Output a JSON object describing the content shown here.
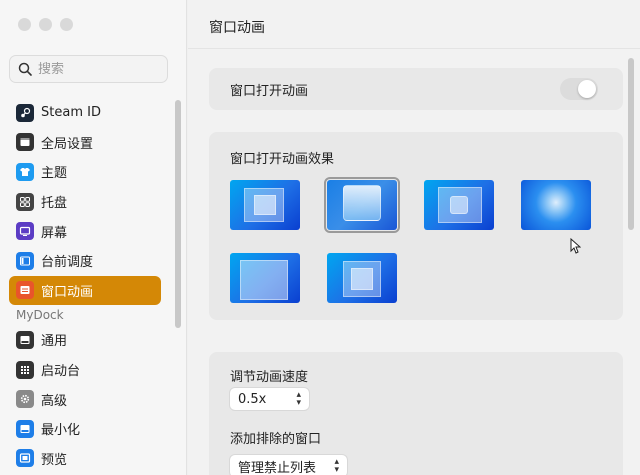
{
  "sidebar": {
    "search_placeholder": "搜索",
    "items": [
      {
        "label": "Steam ID",
        "icon": "steam-icon",
        "color": "#1b2838"
      },
      {
        "label": "全局设置",
        "icon": "window-icon",
        "color": "#333333"
      },
      {
        "label": "主题",
        "icon": "shirt-icon",
        "color": "#1e9bf0"
      },
      {
        "label": "托盘",
        "icon": "tray-grid-icon",
        "color": "#444444"
      },
      {
        "label": "屏幕",
        "icon": "screen-icon",
        "color": "#5b3cc4"
      },
      {
        "label": "台前调度",
        "icon": "stage-manager-icon",
        "color": "#1e7ee8"
      },
      {
        "label": "窗口动画",
        "icon": "window-animation-icon",
        "color": "#ffffff",
        "active": true
      }
    ],
    "section_label": "MyDock",
    "items2": [
      {
        "label": "通用",
        "icon": "general-icon",
        "color": "#333333"
      },
      {
        "label": "启动台",
        "icon": "launchpad-icon",
        "color": "#333333"
      },
      {
        "label": "高级",
        "icon": "gear-icon",
        "color": "#8a8a8a"
      },
      {
        "label": "最小化",
        "icon": "minimize-icon",
        "color": "#1e7ee8"
      },
      {
        "label": "预览",
        "icon": "preview-icon",
        "color": "#1e7ee8"
      }
    ]
  },
  "main": {
    "title": "窗口动画",
    "open_animation_label": "窗口打开动画",
    "open_animation_enabled": false,
    "effect_section_label": "窗口打开动画效果",
    "speed_label": "调节动画速度",
    "speed_value": "0.5x",
    "exclude_label": "添加排除的窗口",
    "exclude_button": "管理禁止列表"
  },
  "colors": {
    "accent": "#d48806",
    "thumb_gradient_start": "#00a6f0",
    "thumb_gradient_end": "#0a3fd0"
  }
}
